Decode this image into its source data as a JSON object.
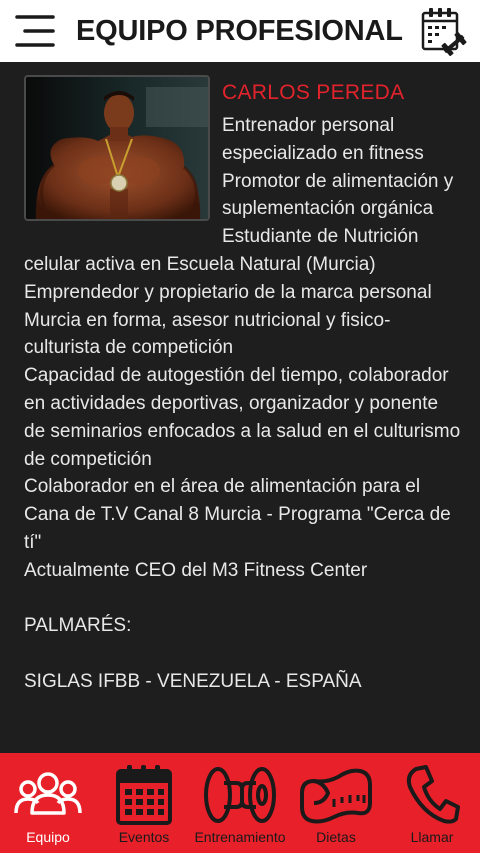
{
  "header": {
    "title": "EQUIPO PROFESIONAL"
  },
  "profile": {
    "name": "CARLOS PEREDA",
    "bio": [
      "Entrenador personal especializado en fitness",
      "Promotor de alimentación y suplementación orgánica",
      "Estudiante de Nutrición celular activa en Escuela Natural (Murcia)",
      "Emprendedor y propietario de la marca personal Murcia en forma, asesor nutricional y fisico-culturista de competición",
      "Capacidad de autogestión del tiempo, colaborador en actividades deportivas, organizador y ponente de seminarios enfocados a la salud en el culturismo de competición",
      "Colaborador en el área de alimentación para el Cana de T.V Canal 8 Murcia - Programa \"Cerca de tí\"",
      "Actualmente CEO del M3 Fitness Center",
      "",
      "PALMARÉS:",
      "",
      "SIGLAS IFBB - VENEZUELA - ESPAÑA"
    ]
  },
  "nav": {
    "items": [
      {
        "label": "Equipo",
        "icon": "team-icon",
        "active": true
      },
      {
        "label": "Eventos",
        "icon": "calendar-icon",
        "active": false
      },
      {
        "label": "Entrenamiento",
        "icon": "weight-plates-icon",
        "active": false
      },
      {
        "label": "Dietas",
        "icon": "measuring-tape-icon",
        "active": false
      },
      {
        "label": "Llamar",
        "icon": "phone-icon",
        "active": false
      }
    ]
  },
  "colors": {
    "accent": "#e8202a",
    "name": "#e3232c",
    "background": "#1e1e1e",
    "header": "#ffffff"
  }
}
